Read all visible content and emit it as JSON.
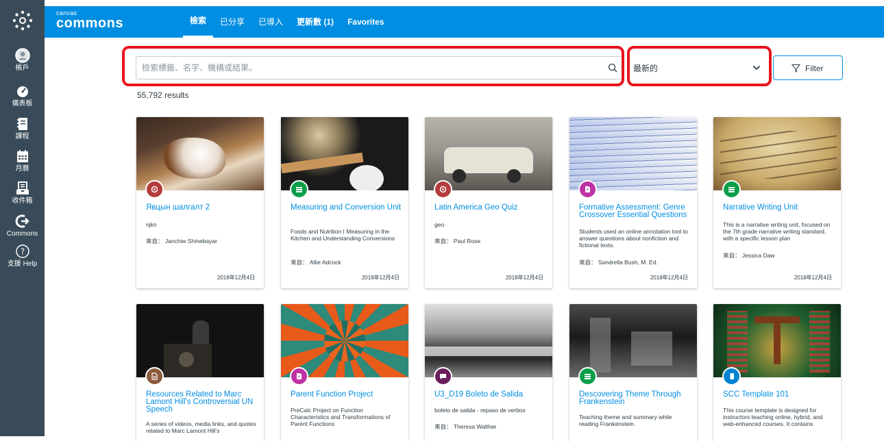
{
  "rail": {
    "items": [
      {
        "label": "帳戶"
      },
      {
        "label": "儀表板"
      },
      {
        "label": "課程"
      },
      {
        "label": "月曆"
      },
      {
        "label": "收件箱"
      },
      {
        "label": "Commons"
      },
      {
        "label": "支援 Help"
      }
    ]
  },
  "brand": {
    "small": "canvas",
    "big": "commons"
  },
  "nav": {
    "items": [
      {
        "label": "檢索"
      },
      {
        "label": "已分享"
      },
      {
        "label": "已導入"
      },
      {
        "label": "更新數 (1)"
      },
      {
        "label": "Favorites"
      }
    ]
  },
  "search": {
    "placeholder": "檢索標籤、名字、機構或結果。",
    "value": ""
  },
  "sort": {
    "selected": "最新的"
  },
  "filter": {
    "label": "Filter"
  },
  "results": {
    "count_text": "55,792 results"
  },
  "colors": {
    "accent": "#008ee2",
    "rail": "#394b58",
    "highlight": "#e8141b"
  },
  "cards": [
    {
      "title": "Явцын шалгалт 2",
      "desc": "njkn",
      "author": "來自： Janchiw Shinebayar",
      "date": "2018年12月4日",
      "type_icon": "quiz-icon",
      "badge_color": "#b53c3c"
    },
    {
      "title": "Measuring and Conversion Unit",
      "desc": "Foods and Nutrition I Measuring in the Kitchen and Understanding Conversions",
      "author": "來自： Allie Adcock",
      "date": "2018年12月4日",
      "type_icon": "module-icon",
      "badge_color": "#0b9e49"
    },
    {
      "title": "Latin America Geo Quiz",
      "desc": "geo",
      "author": "來自： Paul Rose",
      "date": "2018年12月4日",
      "type_icon": "quiz-icon",
      "badge_color": "#b53c3c"
    },
    {
      "title": "Formative Assessment: Genre Crossover Essential Questions",
      "desc": "Students used an online annotation tool to answer questions about nonfiction and fictional texts.",
      "author": "來自： Sandrella Bush, M. Ed.",
      "date": "2018年12月4日",
      "type_icon": "assignment-icon",
      "badge_color": "#bf32a4"
    },
    {
      "title": "Narrative Writing Unit",
      "desc": "This is a narrative writing unit, focused on the 7th grade narrative writing standard, with a specific lesson plan",
      "author": "來自： Jessica Daw",
      "date": "2018年12月4日",
      "type_icon": "module-icon",
      "badge_color": "#0b9e49"
    },
    {
      "title": "Resources Related to Marc Lamont Hill's Controversial UN Speech",
      "desc": "A series of videos, media links, and quotes related to Marc Lamont Hill's",
      "author": "",
      "date": "",
      "type_icon": "page-icon",
      "badge_color": "#8b5a3c"
    },
    {
      "title": "Parent Function Project",
      "desc": "PreCalc Project on Function Characteristics and Transformations of Parent Functions",
      "author": "",
      "date": "",
      "type_icon": "assignment-icon",
      "badge_color": "#bf32a4"
    },
    {
      "title": "U3_D19 Boleto de Salida",
      "desc": "boleto de salida - repaso de verbos",
      "author": "來自： Theresa Walther",
      "date": "",
      "type_icon": "discussion-icon",
      "badge_color": "#6b1f5c"
    },
    {
      "title": "Descovering Theme Through Frankenstein",
      "desc": "Teaching theme and summary while reading Frankenstein.",
      "author": "",
      "date": "",
      "type_icon": "module-icon",
      "badge_color": "#0b9e49"
    },
    {
      "title": "SCC Template 101",
      "desc": "This course template is designed for instructors teaching online, hybrid, and web-enhanced courses. It contains",
      "author": "",
      "date": "",
      "type_icon": "course-icon",
      "badge_color": "#0084d1"
    }
  ]
}
